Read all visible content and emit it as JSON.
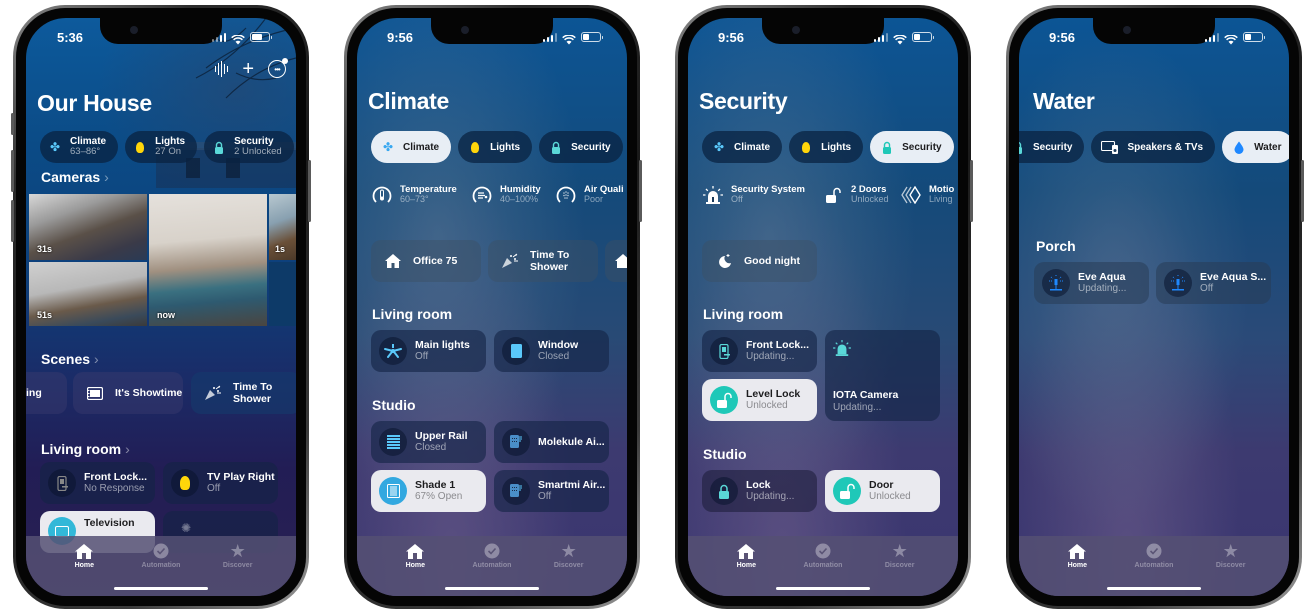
{
  "phones": [
    {
      "status_time": "5:36",
      "title": "Our House",
      "top_buttons": [
        "voice-icon",
        "add-icon",
        "more-icon"
      ],
      "chips": [
        {
          "icon": "fan-icon",
          "label": "Climate",
          "sub": "63–86°"
        },
        {
          "icon": "bulb-icon",
          "label": "Lights",
          "sub": "27 On"
        },
        {
          "icon": "lock-icon",
          "label": "Security",
          "sub": "2 Unlocked"
        }
      ],
      "cameras_header": "Cameras",
      "cameras": [
        {
          "label": "31s"
        },
        {
          "label": "51s"
        },
        {
          "label": "now"
        },
        {
          "label": "1s"
        }
      ],
      "scenes_header": "Scenes",
      "scenes": [
        {
          "icon": "",
          "label": "ing"
        },
        {
          "icon": "film-icon",
          "label": "It's Showtime"
        },
        {
          "icon": "party-popper-icon",
          "label": "Time To Shower"
        }
      ],
      "room_header": "Living room",
      "tiles": [
        {
          "icon": "door-lock-icon",
          "name": "Front Lock...",
          "status": "No Response"
        },
        {
          "icon": "bulb-icon",
          "name": "TV Play Right",
          "status": "Off"
        },
        {
          "icon": "tv-icon",
          "name": "Television",
          "status": ""
        },
        {
          "icon": "sensor-icon",
          "name": "",
          "status": ""
        }
      ]
    },
    {
      "status_time": "9:56",
      "title": "Climate",
      "chips": [
        {
          "icon": "fan-icon",
          "label": "Climate",
          "active": true
        },
        {
          "icon": "bulb-icon",
          "label": "Lights"
        },
        {
          "icon": "lock-icon",
          "label": "Security"
        },
        {
          "icon": "tv-icon",
          "label": ""
        }
      ],
      "summaries": [
        {
          "icon": "thermometer-icon",
          "label": "Temperature",
          "sub": "60–73°"
        },
        {
          "icon": "humidity-icon",
          "label": "Humidity",
          "sub": "40–100%"
        },
        {
          "icon": "air-quality-icon",
          "label": "Air Quali",
          "sub": "Poor"
        }
      ],
      "scenes": [
        {
          "icon": "house-icon",
          "label": "Office 75"
        },
        {
          "icon": "party-popper-icon",
          "label": "Time To Shower"
        }
      ],
      "rooms": [
        {
          "name": "Living room",
          "tiles": [
            {
              "icon": "ceiling-fan-icon",
              "name": "Main lights",
              "status": "Off"
            },
            {
              "icon": "window-icon",
              "name": "Window",
              "status": "Closed"
            }
          ]
        },
        {
          "name": "Studio",
          "tiles": [
            {
              "icon": "blinds-icon",
              "name": "Upper Rail",
              "status": "Closed"
            },
            {
              "icon": "air-purifier-icon",
              "name": "Molekule Ai...",
              "status": ""
            },
            {
              "icon": "shade-icon",
              "name": "Shade 1",
              "status": "67% Open",
              "active": true
            },
            {
              "icon": "air-purifier-icon",
              "name": "Smartmi Air...",
              "status": "Off"
            }
          ]
        }
      ]
    },
    {
      "status_time": "9:56",
      "title": "Security",
      "chips": [
        {
          "icon": "fan-icon",
          "label": "Climate"
        },
        {
          "icon": "bulb-icon",
          "label": "Lights"
        },
        {
          "icon": "lock-icon",
          "label": "Security",
          "active": true
        },
        {
          "icon": "tv-icon",
          "label": ""
        }
      ],
      "summaries": [
        {
          "icon": "alarm-icon",
          "label": "Security System",
          "sub": "Off"
        },
        {
          "icon": "unlock-icon",
          "label": "2 Doors",
          "sub": "Unlocked"
        },
        {
          "icon": "motion-icon",
          "label": "Motio",
          "sub": "Living"
        }
      ],
      "scenes": [
        {
          "icon": "moon-icon",
          "label": "Good night"
        }
      ],
      "rooms": [
        {
          "name": "Living room",
          "tiles": [
            {
              "icon": "door-lock-icon",
              "name": "Front Lock...",
              "status": "Updating..."
            },
            {
              "icon": "alarm-icon",
              "name": "IOTA Camera",
              "status": "Updating..."
            },
            {
              "icon": "unlock-icon",
              "name": "Level Lock",
              "status": "Unlocked",
              "active": true
            }
          ]
        },
        {
          "name": "Studio",
          "tiles": [
            {
              "icon": "lock-icon",
              "name": "Lock",
              "status": "Updating..."
            },
            {
              "icon": "unlock-icon",
              "name": "Door",
              "status": "Unlocked",
              "active": true
            }
          ]
        }
      ]
    },
    {
      "status_time": "9:56",
      "title": "Water",
      "chips": [
        {
          "icon": "lock-icon",
          "label": "Security"
        },
        {
          "icon": "speaker-tv-icon",
          "label": "Speakers & TVs"
        },
        {
          "icon": "water-drop-icon",
          "label": "Water",
          "active": true
        }
      ],
      "rooms": [
        {
          "name": "Porch",
          "tiles": [
            {
              "icon": "sprinkler-icon",
              "name": "Eve Aqua",
              "status": "Updating..."
            },
            {
              "icon": "sprinkler-icon",
              "name": "Eve Aqua S...",
              "status": "Off"
            }
          ]
        }
      ]
    }
  ],
  "tabbar": [
    {
      "icon": "home-icon",
      "label": "Home",
      "active": true
    },
    {
      "icon": "automation-icon",
      "label": "Automation"
    },
    {
      "icon": "star-icon",
      "label": "Discover"
    }
  ],
  "colors": {
    "accent_teal": "#5ad8d8",
    "accent_blue": "#5ac8fa",
    "bulb_yellow": "#ffd60a",
    "unlock_green": "#1fc8b8",
    "drop_blue": "#1e88ff"
  }
}
